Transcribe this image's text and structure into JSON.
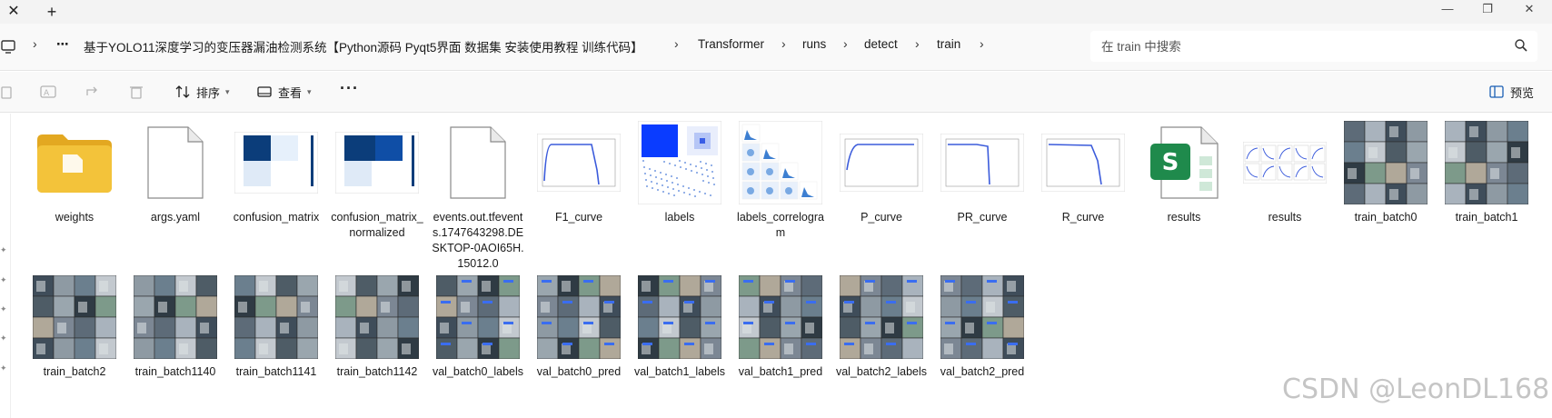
{
  "tabbar": {
    "close_glyph": "✕",
    "new_tab_glyph": "+",
    "minimize_glyph": "—",
    "restore_glyph": "❐",
    "window_close_glyph": "✕"
  },
  "address": {
    "more_glyph": "⋯",
    "breadcrumbs": [
      "基于YOLO11深度学习的变压器漏油检测系统【Python源码 Pyqt5界面 数据集 安装使用教程 训练代码】",
      "Transformer",
      "runs",
      "detect",
      "train"
    ],
    "search_placeholder": "在 train 中搜索"
  },
  "toolbar": {
    "sort_label": "排序",
    "view_label": "查看",
    "more_glyph": "···",
    "preview_label": "预览"
  },
  "files": [
    {
      "name": "weights",
      "icon": "folder-icon"
    },
    {
      "name": "args.yaml",
      "icon": "blank-file-icon"
    },
    {
      "name": "confusion_matrix",
      "icon": "confusion-matrix-thumbnail"
    },
    {
      "name": "confusion_matrix_normalized",
      "icon": "confusion-matrix-thumbnail"
    },
    {
      "name": "events.out.tfevents.1747643298.DESKTOP-0AOI65H.15012.0",
      "icon": "blank-file-icon"
    },
    {
      "name": "F1_curve",
      "icon": "curve-plot-thumbnail"
    },
    {
      "name": "labels",
      "icon": "labels-thumbnail"
    },
    {
      "name": "labels_correlogram",
      "icon": "correlogram-thumbnail"
    },
    {
      "name": "P_curve",
      "icon": "curve-plot-thumbnail"
    },
    {
      "name": "PR_curve",
      "icon": "curve-plot-thumbnail"
    },
    {
      "name": "R_curve",
      "icon": "curve-plot-thumbnail"
    },
    {
      "name": "results",
      "icon": "spreadsheet-icon"
    },
    {
      "name": "results",
      "icon": "results-plot-thumbnail"
    },
    {
      "name": "train_batch0",
      "icon": "photo-grid-thumbnail"
    },
    {
      "name": "train_batch1",
      "icon": "photo-grid-thumbnail"
    },
    {
      "name": "train_batch2",
      "icon": "photo-grid-thumbnail"
    },
    {
      "name": "train_batch1140",
      "icon": "photo-grid-thumbnail"
    },
    {
      "name": "train_batch1141",
      "icon": "photo-grid-thumbnail"
    },
    {
      "name": "train_batch1142",
      "icon": "photo-grid-thumbnail"
    },
    {
      "name": "val_batch0_labels",
      "icon": "photo-grid-thumbnail"
    },
    {
      "name": "val_batch0_pred",
      "icon": "photo-grid-thumbnail"
    },
    {
      "name": "val_batch1_labels",
      "icon": "photo-grid-thumbnail"
    },
    {
      "name": "val_batch1_pred",
      "icon": "photo-grid-thumbnail"
    },
    {
      "name": "val_batch2_labels",
      "icon": "photo-grid-thumbnail"
    },
    {
      "name": "val_batch2_pred",
      "icon": "photo-grid-thumbnail"
    }
  ],
  "watermark": "CSDN @LeonDL168",
  "colors": {
    "folder": "#f3c33a",
    "excel_green": "#1f8a4c",
    "plot_line": "#3b5bdb",
    "heat_dark": "#0b3d7a",
    "label_blue": "#0a3cff"
  }
}
